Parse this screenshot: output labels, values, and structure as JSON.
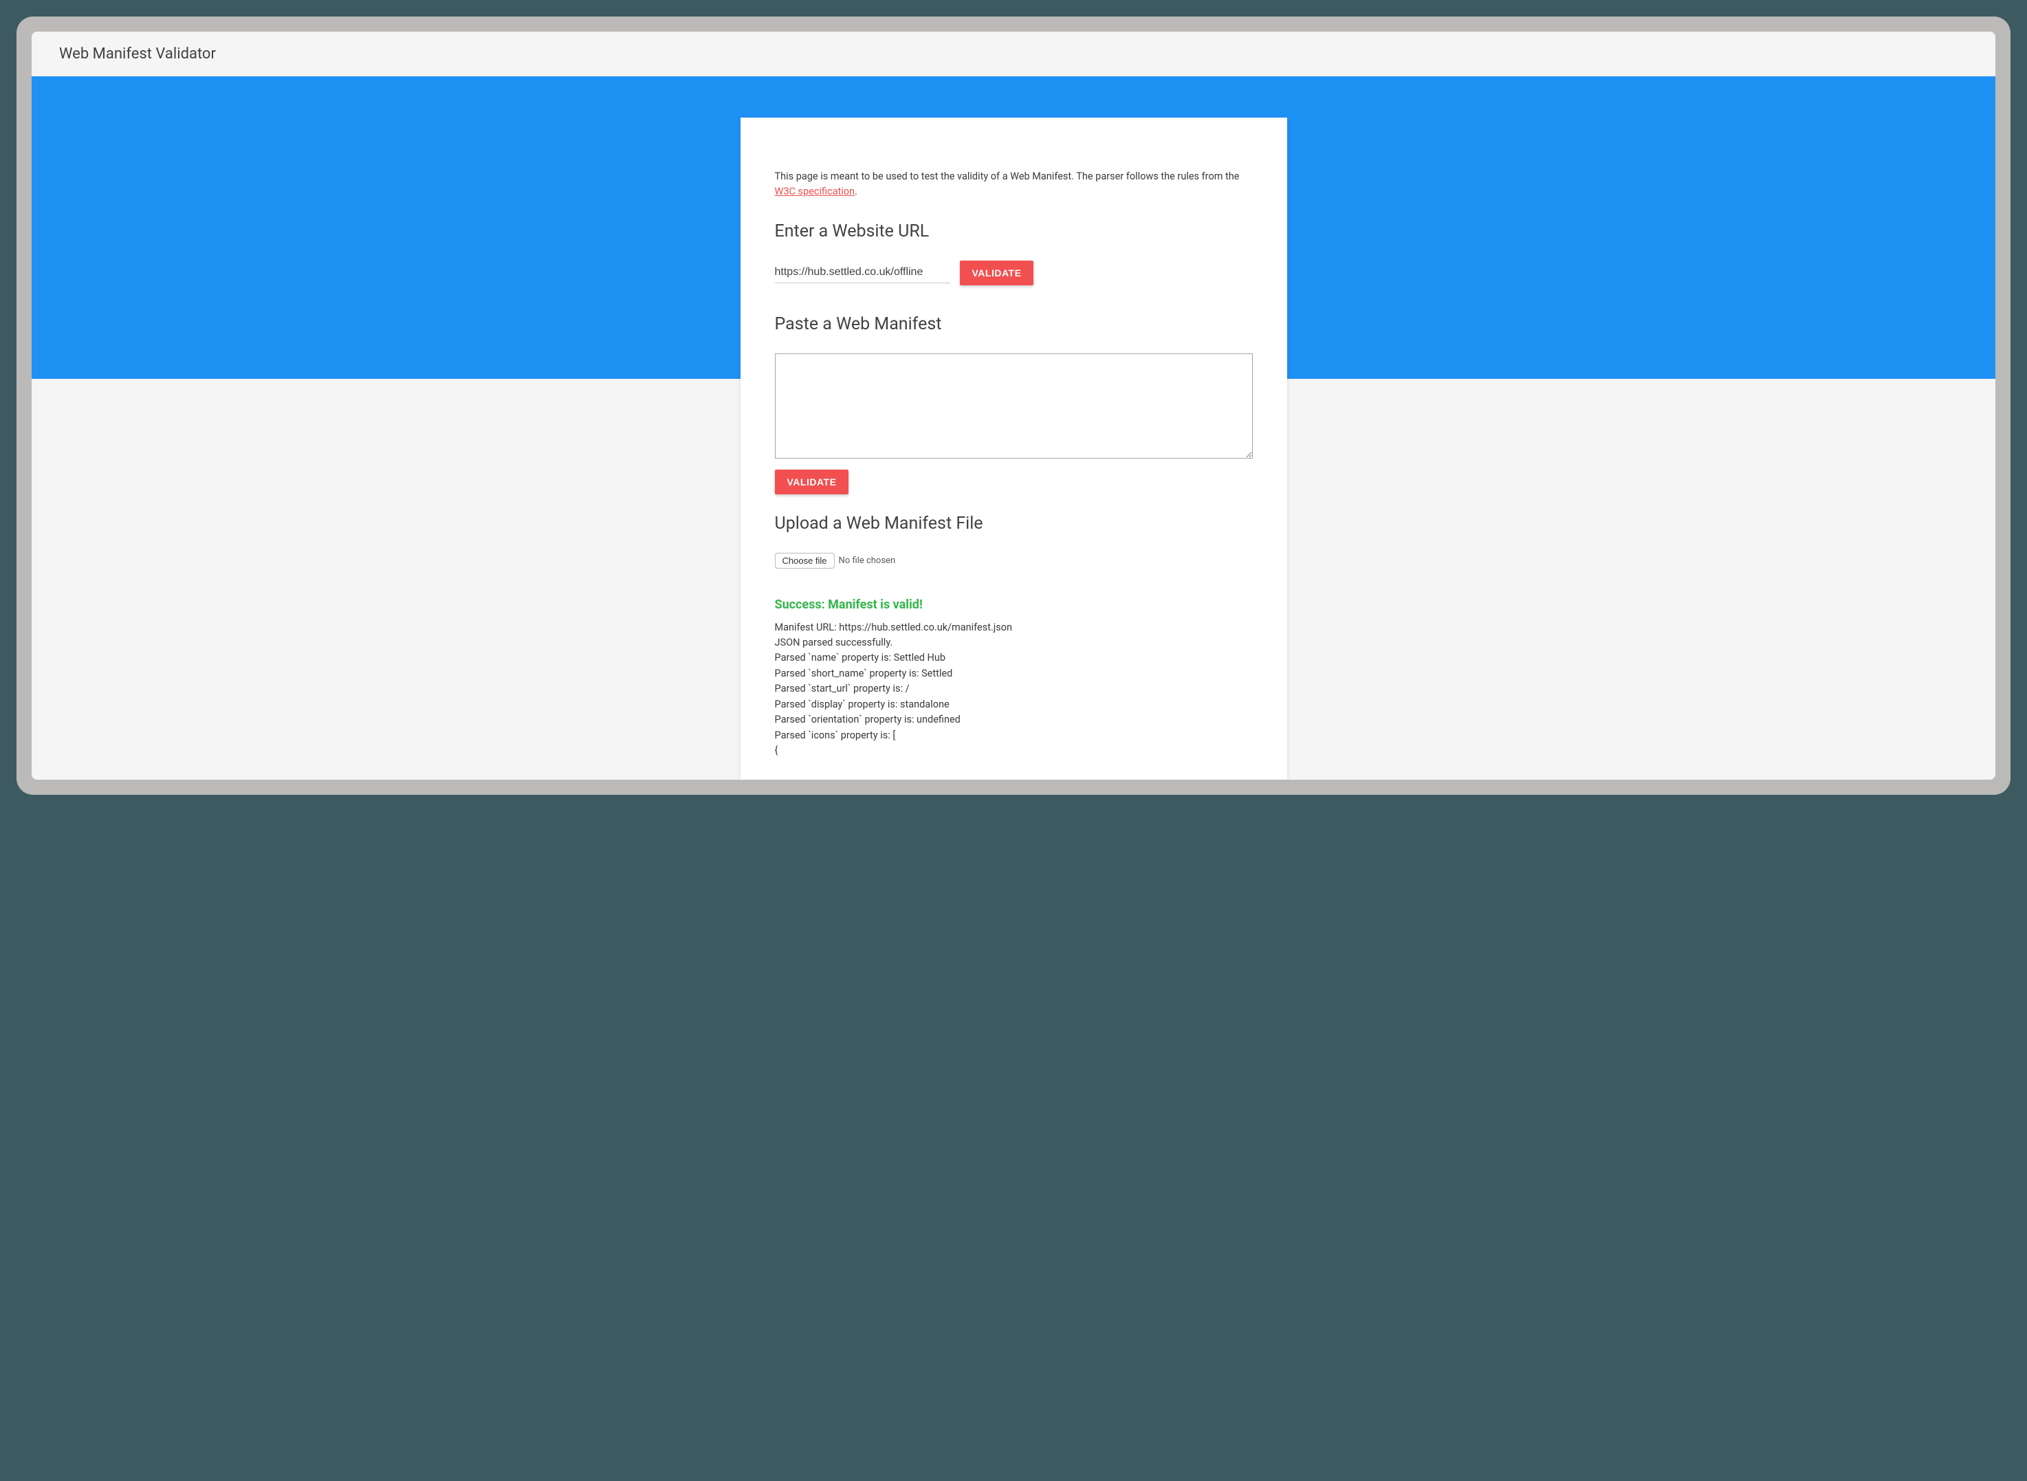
{
  "header": {
    "title": "Web Manifest Validator"
  },
  "intro": {
    "text_before": "This page is meant to be used to test the validity of a Web Manifest. The parser follows the rules from the ",
    "link_text": "W3C specification",
    "text_after": "."
  },
  "sections": {
    "url_heading": "Enter a Website URL",
    "paste_heading": "Paste a Web Manifest",
    "upload_heading": "Upload a Web Manifest File"
  },
  "url_input": {
    "value": "https://hub.settled.co.uk/offline"
  },
  "buttons": {
    "validate_label": "VALIDATE",
    "choose_file_label": "Choose file",
    "no_file_label": "No file chosen"
  },
  "result": {
    "success_heading": "Success: Manifest is valid!",
    "lines": "Manifest URL: https://hub.settled.co.uk/manifest.json\nJSON parsed successfully.\nParsed `name` property is: Settled Hub\nParsed `short_name` property is: Settled\nParsed `start_url` property is: /\nParsed `display` property is: standalone\nParsed `orientation` property is: undefined\nParsed `icons` property is: [\n    {"
  }
}
